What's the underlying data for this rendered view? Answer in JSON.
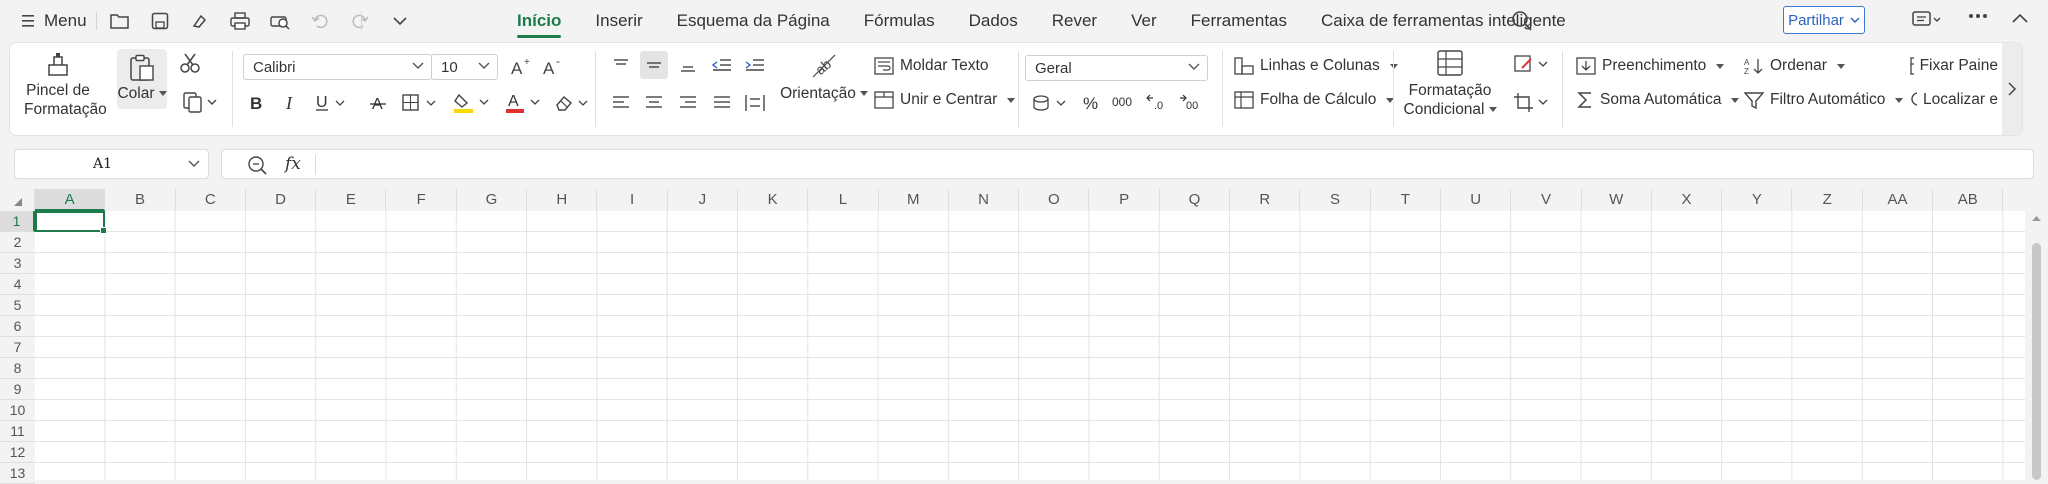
{
  "menubar": {
    "menu_label": "Menu",
    "tabs": [
      "Início",
      "Inserir",
      "Esquema da Página",
      "Fórmulas",
      "Dados",
      "Rever",
      "Ver",
      "Ferramentas",
      "Caixa de ferramentas inteligente"
    ],
    "active_tab": "Início",
    "share_label": "Partilhar"
  },
  "ribbon": {
    "format_painter": "Pincel de Formatação",
    "paste": "Colar",
    "font_name": "Calibri",
    "font_size": "10",
    "wrap_text": "Moldar Texto",
    "merge_center": "Unir e Centrar",
    "orientation": "Orientação",
    "number_format": "Geral",
    "rows_columns": "Linhas e Colunas",
    "worksheet": "Folha de Cálculo",
    "conditional_formatting": "Formatação Condicional",
    "fill": "Preenchimento",
    "sort": "Ordenar",
    "freeze_panes": "Fixar Paine",
    "autosum": "Soma Automática",
    "autofilter": "Filtro Automático",
    "find": "Localizar e",
    "colors": {
      "accent": "#1d7a4a",
      "font_color": "#e03131",
      "highlight": "#f5d90a"
    }
  },
  "formula_bar": {
    "name_box": "A1",
    "fx_label": "fx",
    "formula": ""
  },
  "grid": {
    "columns": [
      "A",
      "B",
      "C",
      "D",
      "E",
      "F",
      "G",
      "H",
      "I",
      "J",
      "K",
      "L",
      "M",
      "N",
      "O",
      "P",
      "Q",
      "R",
      "S",
      "T",
      "U",
      "V",
      "W",
      "X",
      "Y",
      "Z",
      "AA",
      "AB"
    ],
    "rows": [
      "1",
      "2",
      "3",
      "4",
      "5",
      "6",
      "7",
      "8",
      "9",
      "10",
      "11",
      "12",
      "13"
    ],
    "selected_cell": "A1"
  }
}
